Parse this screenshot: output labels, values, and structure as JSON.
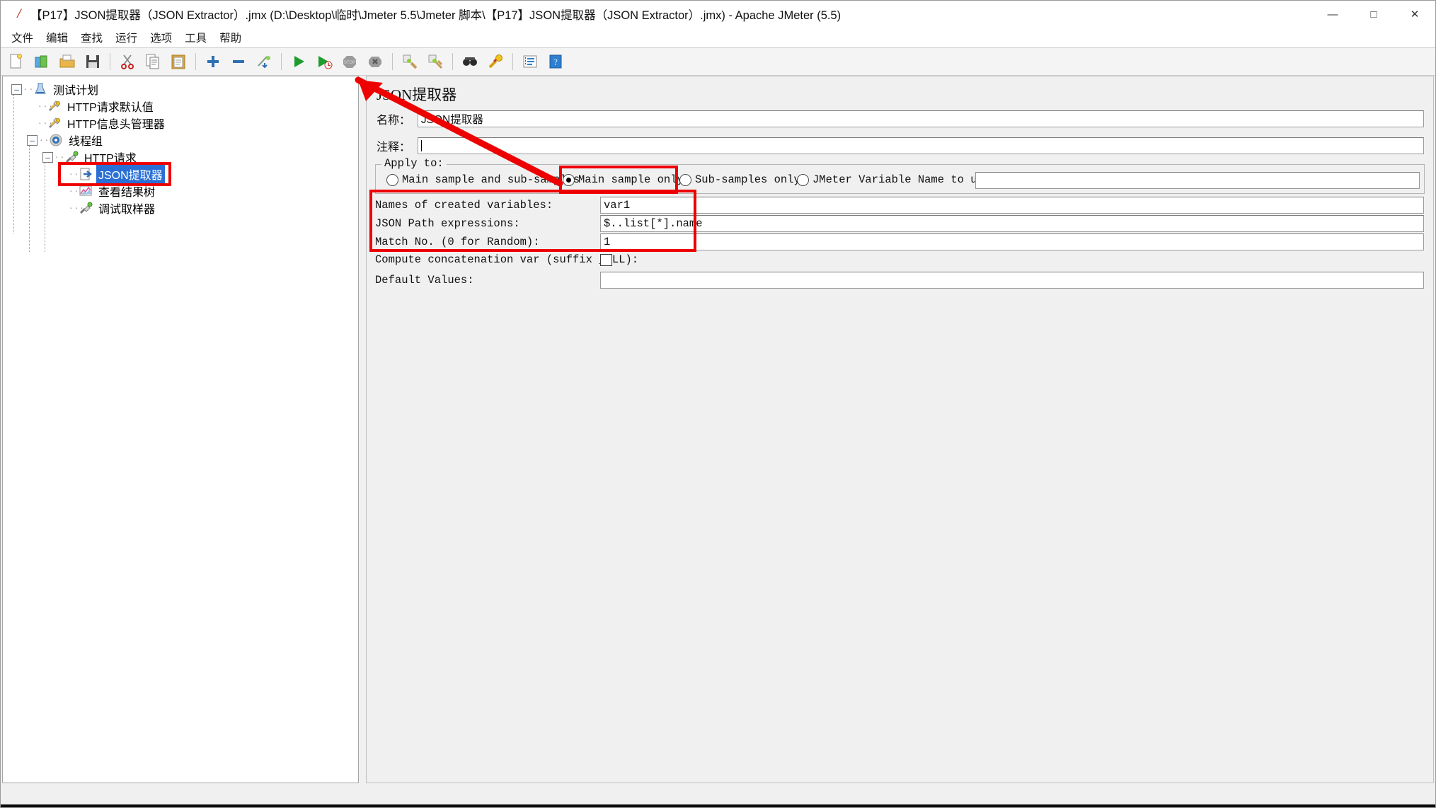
{
  "window": {
    "title": "【P17】JSON提取器（JSON Extractor）.jmx (D:\\Desktop\\临时\\Jmeter 5.5\\Jmeter 脚本\\【P17】JSON提取器（JSON Extractor）.jmx) - Apache JMeter (5.5)",
    "app_icon": "jmeter-feather-icon",
    "minimize_label": "—",
    "maximize_label": "□",
    "close_label": "✕"
  },
  "menubar": {
    "items": [
      {
        "label": "文件",
        "name": "menu-file"
      },
      {
        "label": "编辑",
        "name": "menu-edit"
      },
      {
        "label": "查找",
        "name": "menu-search"
      },
      {
        "label": "运行",
        "name": "menu-run"
      },
      {
        "label": "选项",
        "name": "menu-options"
      },
      {
        "label": "工具",
        "name": "menu-tools"
      },
      {
        "label": "帮助",
        "name": "menu-help"
      }
    ]
  },
  "toolbar": {
    "buttons": [
      {
        "name": "new-icon",
        "glyph": "📄",
        "title": "New"
      },
      {
        "name": "templates-icon",
        "glyph": "📗",
        "title": "Templates"
      },
      {
        "name": "open-icon",
        "glyph": "📂",
        "title": "Open"
      },
      {
        "name": "save-icon",
        "glyph": "💾",
        "title": "Save"
      },
      {
        "name": "cut-icon",
        "glyph": "✂",
        "title": "Cut"
      },
      {
        "name": "copy-icon",
        "glyph": "📄",
        "title": "Copy"
      },
      {
        "name": "paste-icon",
        "glyph": "📋",
        "title": "Paste"
      },
      {
        "name": "expand-all-icon",
        "glyph": "✚",
        "title": "Expand all"
      },
      {
        "name": "collapse-all-icon",
        "glyph": "➖",
        "title": "Collapse all"
      },
      {
        "name": "toggle-icon",
        "glyph": "✎",
        "title": "Toggle"
      },
      {
        "name": "start-icon",
        "glyph": "▶",
        "title": "Start"
      },
      {
        "name": "start-no-timers-icon",
        "glyph": "▶",
        "title": "Start no pauses"
      },
      {
        "name": "stop-icon",
        "glyph": "⏹",
        "title": "Stop"
      },
      {
        "name": "shutdown-icon",
        "glyph": "✖",
        "title": "Shutdown"
      },
      {
        "name": "clear-icon",
        "glyph": "🧹",
        "title": "Clear"
      },
      {
        "name": "clear-all-icon",
        "glyph": "🧹",
        "title": "Clear all"
      },
      {
        "name": "search-icon",
        "glyph": "🔎",
        "title": "Search"
      },
      {
        "name": "reset-search-icon",
        "glyph": "🔑",
        "title": "Reset search"
      },
      {
        "name": "function-helper-icon",
        "glyph": "☰",
        "title": "Function helper"
      },
      {
        "name": "help-icon",
        "glyph": "?",
        "title": "Help"
      }
    ]
  },
  "tree": {
    "nodes": [
      {
        "name": "tree-node-test-plan",
        "label": "测试计划",
        "depth": 0,
        "icon": "test-plan-icon",
        "toggle": "minus",
        "selected": false
      },
      {
        "name": "tree-node-http-defaults",
        "label": "HTTP请求默认值",
        "depth": 1,
        "icon": "config-element-icon",
        "toggle": "none",
        "selected": false
      },
      {
        "name": "tree-node-http-header-mgr",
        "label": "HTTP信息头管理器",
        "depth": 1,
        "icon": "config-element-icon",
        "toggle": "none",
        "selected": false
      },
      {
        "name": "tree-node-thread-group",
        "label": "线程组",
        "depth": 1,
        "icon": "thread-group-icon",
        "toggle": "minus",
        "selected": false
      },
      {
        "name": "tree-node-http-request",
        "label": "HTTP请求",
        "depth": 2,
        "icon": "sampler-icon",
        "toggle": "minus",
        "selected": false
      },
      {
        "name": "tree-node-json-extractor",
        "label": "JSON提取器",
        "depth": 3,
        "icon": "post-processor-icon",
        "toggle": "none",
        "selected": true
      },
      {
        "name": "tree-node-view-results",
        "label": "查看结果树",
        "depth": 3,
        "icon": "listener-icon",
        "toggle": "none",
        "selected": false
      },
      {
        "name": "tree-node-debug-sampler",
        "label": "调试取样器",
        "depth": 3,
        "icon": "sampler-icon",
        "toggle": "none",
        "selected": false
      }
    ]
  },
  "form": {
    "panel_title": "JSON提取器",
    "name_label": "名称：",
    "name_value": "JSON提取器",
    "comment_label": "注释：",
    "comment_value": "",
    "apply_to_legend": "Apply to:",
    "radios": [
      {
        "name": "radio-main-and-sub",
        "label": "Main sample and sub-samples",
        "selected": false
      },
      {
        "name": "radio-main-only",
        "label": "Main sample only",
        "selected": true
      },
      {
        "name": "radio-sub-only",
        "label": "Sub-samples only",
        "selected": false
      },
      {
        "name": "radio-jmeter-var",
        "label": "JMeter Variable Name to use",
        "selected": false
      }
    ],
    "jmeter_variable_value": "",
    "fields": [
      {
        "name": "field-variable-names",
        "label": "Names of created variables:",
        "value": "var1"
      },
      {
        "name": "field-json-path",
        "label": "JSON Path expressions:",
        "value": "$..list[*].name"
      },
      {
        "name": "field-match-no",
        "label": "Match No. (0 for Random):",
        "value": "1"
      }
    ],
    "concat_label": "Compute concatenation var (suffix _ALL):",
    "concat_checked": false,
    "default_values_label": "Default Values:",
    "default_values_value": ""
  },
  "annotations": {
    "accent_color": "#ee0000",
    "boxes": [
      {
        "name": "annotation-box-tree-selection"
      },
      {
        "name": "annotation-box-main-sample-only"
      },
      {
        "name": "annotation-box-extractor-fields"
      }
    ],
    "arrow": {
      "name": "annotation-arrow-to-radio"
    }
  }
}
